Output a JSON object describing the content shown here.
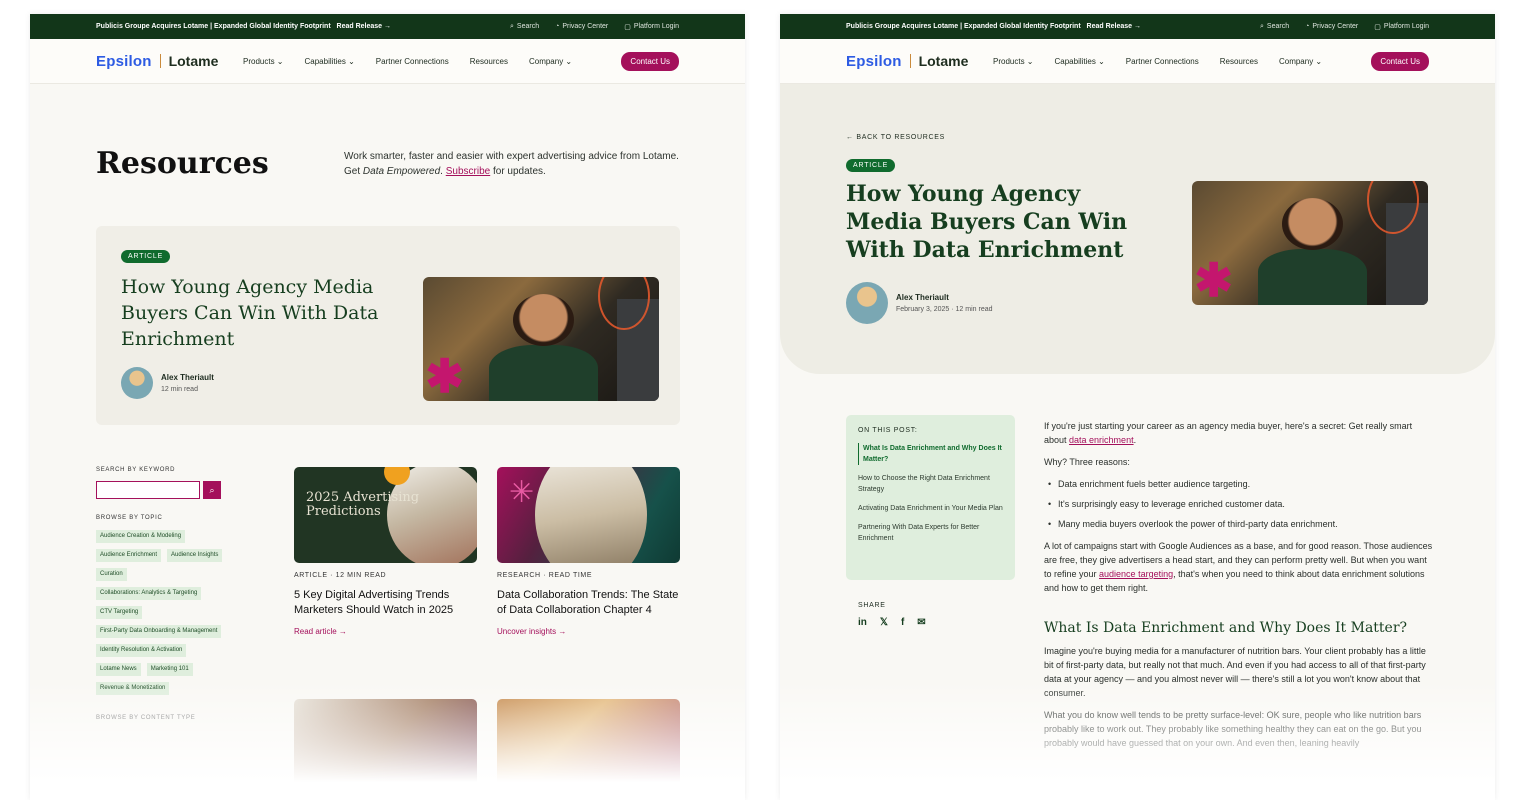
{
  "topbar": {
    "announcement": "Publicis Groupe Acquires Lotame | Expanded Global Identity Footprint",
    "read_release": "Read Release →",
    "search": "Search",
    "privacy": "Privacy Center",
    "login": "Platform Login",
    "search_icon": "⌕",
    "privacy_icon": "◔",
    "login_icon": "▢"
  },
  "nav": {
    "logo_epsilon": "Epsilon",
    "logo_lotame": "Lotame",
    "products": "Products ⌄",
    "capabilities": "Capabilities ⌄",
    "partner": "Partner Connections",
    "resources": "Resources",
    "company": "Company ⌄",
    "contact": "Contact Us"
  },
  "resources_page": {
    "title": "Resources",
    "intro_a": "Work smarter, faster and easier with expert advertising advice from Lotame. Get ",
    "intro_em": "Data Empowered",
    "intro_b": ". ",
    "intro_link": "Subscribe",
    "intro_c": " for updates.",
    "featured": {
      "badge": "ARTICLE",
      "title": "How Young Agency Media Buyers Can Win With Data Enrichment",
      "author": "Alex Theriault",
      "meta": "12 min read"
    },
    "sidebar": {
      "search_heading": "SEARCH BY KEYWORD",
      "search_placeholder": "",
      "search_icon": "⌕",
      "topic_heading": "BROWSE BY TOPIC",
      "topics": [
        "Audience Creation & Modeling",
        "Audience Enrichment",
        "Audience Insights",
        "Curation",
        "Collaborations: Analytics & Targeting",
        "CTV Targeting",
        "First-Party Data Onboarding & Management",
        "Identity Resolution & Activation",
        "Lotame News",
        "Marketing 101",
        "Revenue & Monetization"
      ],
      "content_type_heading": "BROWSE BY CONTENT TYPE"
    },
    "cards": [
      {
        "image_text": "2025 Advertising Predictions",
        "meta": "ARTICLE · 12 MIN READ",
        "title": "5 Key Digital Advertising Trends Marketers Should Watch in 2025",
        "link": "Read article →"
      },
      {
        "meta": "RESEARCH · READ TIME",
        "title": "Data Collaboration Trends: The State of Data Collaboration Chapter 4",
        "link": "Uncover insights →"
      }
    ]
  },
  "article_page": {
    "back": "← BACK TO RESOURCES",
    "badge": "ARTICLE",
    "title": "How Young Agency Media Buyers Can Win With Data Enrichment",
    "author": "Alex Theriault",
    "meta": "February 3, 2025 · 12 min read",
    "toc_heading": "ON THIS POST:",
    "toc": [
      "What Is Data Enrichment and Why Does It Matter?",
      "How to Choose the Right Data Enrichment Strategy",
      "Activating Data Enrichment in Your Media Plan",
      "Partnering With Data Experts for Better Enrichment"
    ],
    "share_heading": "SHARE",
    "share_icons": [
      "in",
      "𝕏",
      "f",
      "✉"
    ],
    "p1_a": "If you're just starting your career as an agency media buyer, here's a secret: Get really smart about ",
    "p1_link": "data enrichment",
    "p1_b": ".",
    "p2": "Why? Three reasons:",
    "bullets": [
      "Data enrichment fuels better audience targeting.",
      "It's surprisingly easy to leverage enriched customer data.",
      "Many media buyers overlook the power of third-party data enrichment."
    ],
    "p3_a": "A lot of campaigns start with Google Audiences as a base, and for good reason. Those audiences are free, they give advertisers a head start, and they can perform pretty well. But when you want to refine your ",
    "p3_link": "audience targeting",
    "p3_b": ", that's when you need to think about data enrichment solutions and how to get them right.",
    "h2": "What Is Data Enrichment and Why Does It Matter?",
    "p4": "Imagine you're buying media for a manufacturer of nutrition bars. Your client probably has a little bit of first-party data, but really not that much. And even if you had access to all of that first-party data at your agency — and you almost never will — there's still a lot you won't know about that consumer.",
    "p5": "What you do know well tends to be pretty surface-level: OK sure, people who like nutrition bars probably like to work out. They probably like something healthy they can eat on the go. But you probably would have guessed that on your own. And even then, leaning heavily"
  }
}
